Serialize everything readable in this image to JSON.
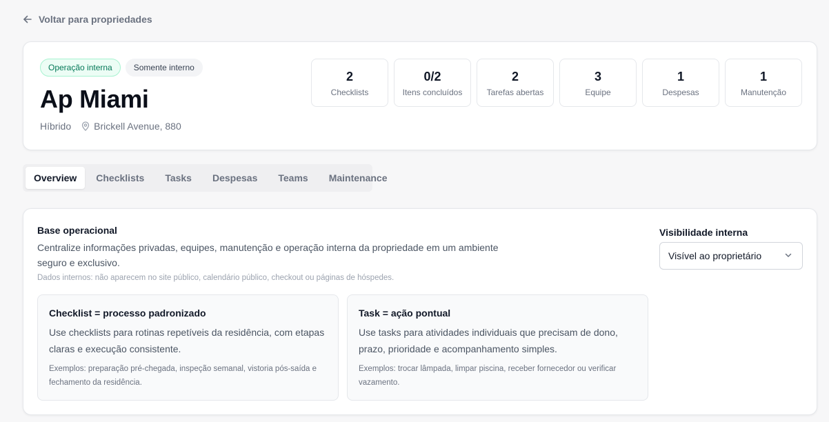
{
  "nav": {
    "back_label": "Voltar para propriedades"
  },
  "property": {
    "badges": [
      "Operação interna",
      "Somente interno"
    ],
    "name": "Ap Miami",
    "type": "Híbrido",
    "address": "Brickell Avenue, 880"
  },
  "stats": [
    {
      "value": "2",
      "label": "Checklists"
    },
    {
      "value": "0/2",
      "label": "Itens concluídos"
    },
    {
      "value": "2",
      "label": "Tarefas abertas"
    },
    {
      "value": "3",
      "label": "Equipe"
    },
    {
      "value": "1",
      "label": "Despesas"
    },
    {
      "value": "1",
      "label": "Manutenção"
    }
  ],
  "tabs": [
    {
      "label": "Overview",
      "active": true
    },
    {
      "label": "Checklists",
      "active": false
    },
    {
      "label": "Tasks",
      "active": false
    },
    {
      "label": "Despesas",
      "active": false
    },
    {
      "label": "Teams",
      "active": false
    },
    {
      "label": "Maintenance",
      "active": false
    }
  ],
  "overview": {
    "title": "Base operacional",
    "description": "Centralize informações privadas, equipes, manutenção e operação interna da propriedade em um ambiente seguro e exclusivo.",
    "note": "Dados internos: não aparecem no site público, calendário público, checkout ou páginas de hóspedes.",
    "cards": [
      {
        "title": "Checklist = processo padronizado",
        "body": "Use checklists para rotinas repetíveis da residência, com etapas claras e execução consistente.",
        "example": "Exemplos: preparação pré-chegada, inspeção semanal, vistoria pós-saída e fechamento da residência."
      },
      {
        "title": "Task = ação pontual",
        "body": "Use tasks para atividades individuais que precisam de dono, prazo, prioridade e acompanhamento simples.",
        "example": "Exemplos: trocar lâmpada, limpar piscina, receber fornecedor ou verificar vazamento."
      }
    ]
  },
  "visibility": {
    "label": "Visibilidade interna",
    "selected": "Visível ao proprietário"
  },
  "colors": {
    "accent_green": "#047857",
    "badge_green_bg": "#ecfdf5",
    "text_primary": "#111827",
    "text_muted": "#6b7280"
  },
  "icons": [
    "arrow-left-icon",
    "map-pin-icon",
    "chevron-down-icon"
  ]
}
